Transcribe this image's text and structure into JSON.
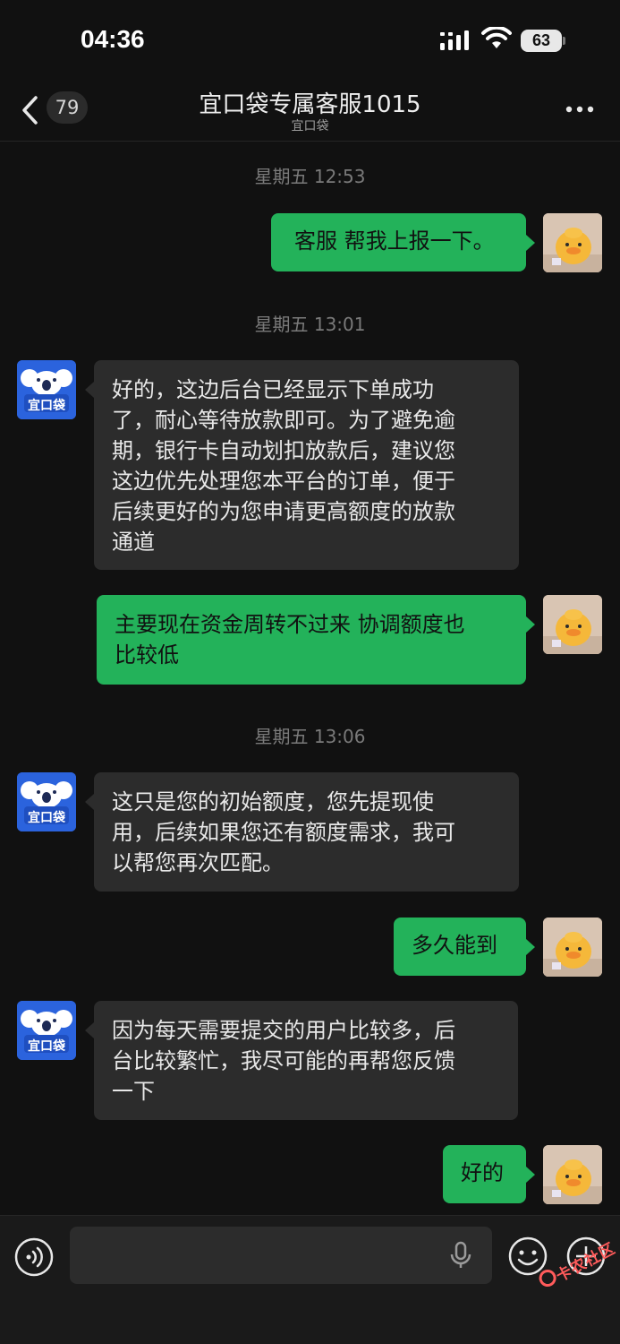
{
  "status_bar": {
    "time": "04:36",
    "battery": "63"
  },
  "nav": {
    "unread_count": "79",
    "title": "宜口袋专属客服1015",
    "subtitle": "宜口袋"
  },
  "messages": [
    {
      "type": "timestamp",
      "text": "星期五 12:53"
    },
    {
      "type": "sent",
      "text": "客服 帮我上报一下。"
    },
    {
      "type": "timestamp",
      "text": "星期五 13:01"
    },
    {
      "type": "received",
      "lines": [
        "好的，这边后台已经显示下单成功",
        "了，耐心等待放款即可。为了避免逾",
        "期，银行卡自动划扣放款后，建议您",
        "这边优先处理您本平台的订单，便于",
        "后续更好的为您申请更高额度的放款",
        "通道"
      ]
    },
    {
      "type": "sent",
      "lines": [
        "主要现在资金周转不过来 协调额度也",
        "比较低"
      ]
    },
    {
      "type": "timestamp",
      "text": "星期五 13:06"
    },
    {
      "type": "received",
      "lines": [
        "这只是您的初始额度，您先提现使",
        "用，后续如果您还有额度需求，我可",
        "以帮您再次匹配。"
      ]
    },
    {
      "type": "sent",
      "text": "多久能到"
    },
    {
      "type": "received",
      "lines": [
        "因为每天需要提交的用户比较多，后",
        "台比较繁忙，我尽可能的再帮您反馈",
        "一下"
      ]
    },
    {
      "type": "sent",
      "text": "好的"
    }
  ],
  "agent_avatar_label": "宜口袋",
  "input": {
    "value": ""
  },
  "watermark": "卡农社区",
  "colors": {
    "sent_bubble": "#23b25a",
    "received_bubble": "#2c2c2c",
    "agent_avatar": "#2b63dd",
    "background": "#111111"
  },
  "icons": [
    "signal-icon",
    "wifi-icon",
    "back-icon",
    "more-icon",
    "voice-icon",
    "mic-icon",
    "emoji-icon",
    "plus-icon"
  ]
}
